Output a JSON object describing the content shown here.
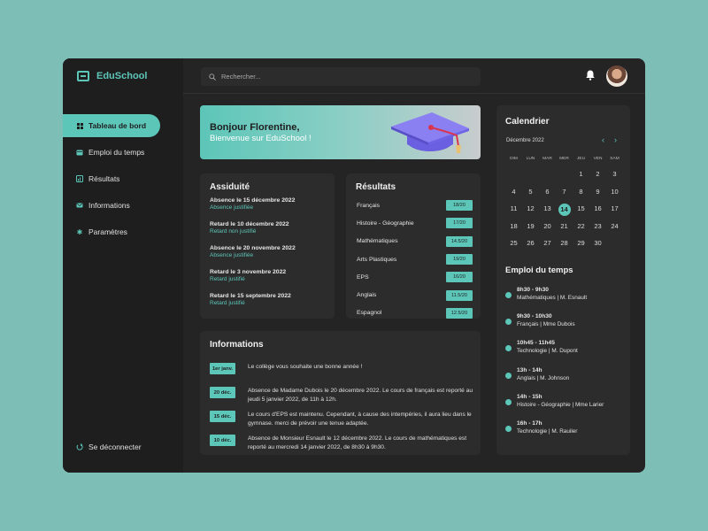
{
  "app": {
    "name": "EduSchool"
  },
  "sidebar": {
    "items": [
      {
        "label": "Tableau de bord",
        "icon": "grid-icon"
      },
      {
        "label": "Emploi du temps",
        "icon": "calendar-icon"
      },
      {
        "label": "Résultats",
        "icon": "chart-icon"
      },
      {
        "label": "Informations",
        "icon": "mail-icon"
      },
      {
        "label": "Paramètres",
        "icon": "gear-icon"
      }
    ],
    "logout": "Se déconnecter"
  },
  "search": {
    "placeholder": "Rechercher..."
  },
  "banner": {
    "title": "Bonjour Florentine,",
    "subtitle": "Bienvenue sur EduSchool !"
  },
  "attendance": {
    "title": "Assiduité",
    "items": [
      {
        "title": "Absence le 15 décembre 2022",
        "status": "Absence justifiée"
      },
      {
        "title": "Retard le 10 décembre 2022",
        "status": "Retard non justifié"
      },
      {
        "title": "Absence le 20 novembre 2022",
        "status": "Absence justifiée"
      },
      {
        "title": "Retard le 3 novembre 2022",
        "status": "Retard justifié"
      },
      {
        "title": "Retard le 15 septembre 2022",
        "status": "Retard justifié"
      }
    ]
  },
  "results": {
    "title": "Résultats",
    "items": [
      {
        "subject": "Français",
        "grade": "18/20"
      },
      {
        "subject": "Histoire - Géographie",
        "grade": "17/20"
      },
      {
        "subject": "Mathématiques",
        "grade": "14.5/20"
      },
      {
        "subject": "Arts Plastiques",
        "grade": "19/20"
      },
      {
        "subject": "EPS",
        "grade": "16/20"
      },
      {
        "subject": "Anglais",
        "grade": "11.5/20"
      },
      {
        "subject": "Espagnol",
        "grade": "12.5/20"
      }
    ]
  },
  "informations": {
    "title": "Informations",
    "items": [
      {
        "date": "1er janv.",
        "text": "Le collège vous souhaite une bonne année !"
      },
      {
        "date": "20 déc.",
        "text": "Absence de Madame Dubois le 20 décembre 2022. Le cours de français est reporté au jeudi 5 janvier 2022, de 11h à 12h."
      },
      {
        "date": "15 déc.",
        "text": "Le cours d'EPS est maintenu. Cependant, à cause des intempéries, il aura lieu dans le gymnase. merci de prévoir une tenue adaptée."
      },
      {
        "date": "10 déc.",
        "text": "Absence de Monsieur Esnault le 12 décembre 2022. Le cours de mathématiques est reporté au mercredi 14 janvier 2022, de 8h30 à 9h30."
      }
    ]
  },
  "calendar": {
    "title": "Calendrier",
    "month": "Décembre 2022",
    "prev": "‹",
    "next": "›",
    "weekdays": [
      "DIM",
      "LUN",
      "MAR",
      "MER",
      "JEU",
      "VEN",
      "SAM"
    ],
    "leading_blanks": 4,
    "days": 30,
    "today": 14
  },
  "schedule": {
    "title": "Emploi du temps",
    "items": [
      {
        "time": "8h30 - 9h30",
        "detail": "Mathématiques | M. Esnault"
      },
      {
        "time": "9h30 - 10h30",
        "detail": "Français | Mme Dubois"
      },
      {
        "time": "10h45 - 11h45",
        "detail": "Technologie | M. Dupont"
      },
      {
        "time": "13h - 14h",
        "detail": "Anglais | M. Johnson"
      },
      {
        "time": "14h - 15h",
        "detail": "Histoire - Géographie | Mme Larier"
      },
      {
        "time": "16h - 17h",
        "detail": "Technologie | M. Rauiler"
      }
    ]
  },
  "colors": {
    "accent": "#5cc6b8",
    "background": "#7dbfb6",
    "panel": "#252425",
    "card": "#2d2c2d"
  }
}
